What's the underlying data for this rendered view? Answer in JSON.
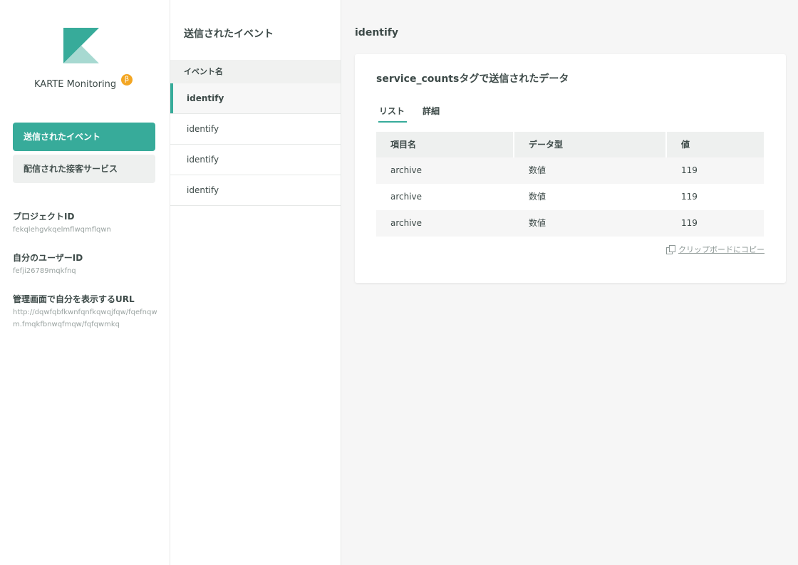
{
  "brand": {
    "name": "KARTE Monitoring",
    "badge": "β",
    "colors": {
      "primary": "#37ab9a",
      "light": "#a7d9d1",
      "badge": "#f3a623"
    }
  },
  "sidebar": {
    "nav": [
      {
        "label": "送信されたイベント",
        "active": true
      },
      {
        "label": "配信された接客サービス",
        "active": false
      }
    ],
    "info": [
      {
        "label": "プロジェクトID",
        "value": "fekqlehgvkqelmflwqmflqwn"
      },
      {
        "label": "自分のユーザーID",
        "value": "fefji26789mqkfnq"
      },
      {
        "label": "管理画面で自分を表示するURL",
        "value": "http://dqwfqbfkwnfqnfkqwqjfqw/fqefnqwm.fmqkfbnwqfmqw/fqfqwmkq"
      }
    ]
  },
  "middle": {
    "title": "送信されたイベント",
    "column_header": "イベント名",
    "events": [
      "identify",
      "identify",
      "identify",
      "identify"
    ]
  },
  "main": {
    "title": "identify",
    "card": {
      "title": "service_countsタグで送信されたデータ",
      "tabs": [
        "リスト",
        "詳細"
      ],
      "table": {
        "headers": [
          "項目名",
          "データ型",
          "値"
        ],
        "rows": [
          [
            "archive",
            "数値",
            "119"
          ],
          [
            "archive",
            "数値",
            "119"
          ],
          [
            "archive",
            "数値",
            "119"
          ]
        ]
      },
      "copy_label": "クリップボードにコピー"
    }
  }
}
